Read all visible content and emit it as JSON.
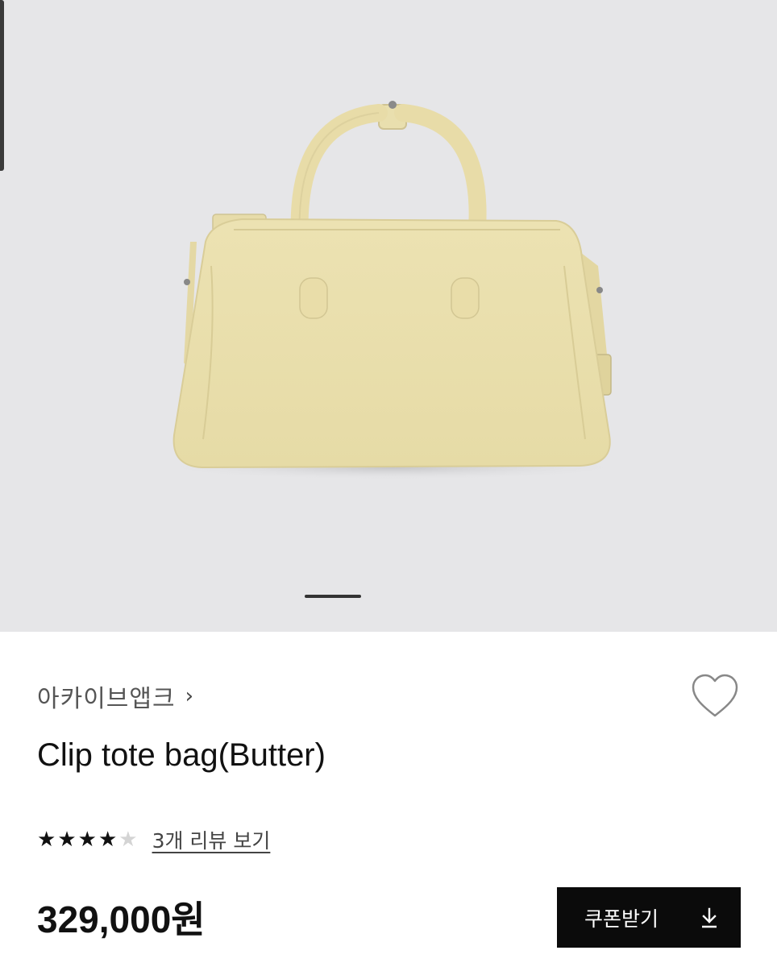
{
  "product": {
    "brand": "아카이브앱크",
    "brand_chevron": "›",
    "name": "Clip tote bag(Butter)",
    "rating": 4,
    "rating_max": 5,
    "review_link": "3개 리뷰 보기",
    "price": "329,000원",
    "coupon_button": "쿠폰받기"
  },
  "gallery": {
    "current_slide": 1,
    "bag_color": "#ede4b6",
    "background_color": "#e6e6e8"
  },
  "icons": {
    "wishlist": "heart-outline-icon",
    "coupon": "download-icon",
    "rating": "star-icon"
  }
}
